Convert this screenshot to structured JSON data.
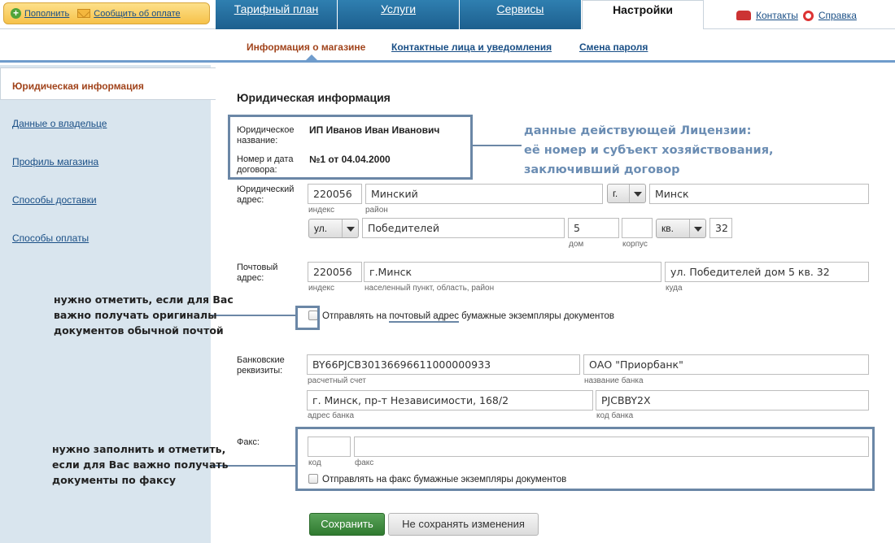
{
  "top_bar": {
    "topup_label": "Пополнить",
    "report_payment_label": "Сообщить об оплате",
    "tabs": [
      {
        "label": "Тарифный план"
      },
      {
        "label": "Услуги"
      },
      {
        "label": "Сервисы"
      },
      {
        "label": "Настройки"
      }
    ],
    "contacts_label": "Контакты",
    "help_label": "Справка"
  },
  "subnav": {
    "items": [
      {
        "label": "Информация о магазине"
      },
      {
        "label": "Контактные лица и уведомления"
      },
      {
        "label": "Смена пароля"
      }
    ]
  },
  "sidebar": {
    "items": [
      {
        "label": "Юридическая информация"
      },
      {
        "label": "Данные о владельце"
      },
      {
        "label": "Профиль магазина"
      },
      {
        "label": "Способы доставки"
      },
      {
        "label": "Способы оплаты"
      }
    ]
  },
  "form": {
    "title": "Юридическая информация",
    "legal_name_label": "Юридическое название:",
    "legal_name_value": "ИП Иванов Иван Иванович",
    "contract_label": "Номер и дата договора:",
    "contract_value": "№1 от 04.04.2000",
    "legal_address": {
      "label": "Юридический адрес:",
      "index": "220056",
      "district": "Минский",
      "locality_type": "г.",
      "locality": "Минск",
      "street_type": "ул.",
      "street": "Победителей",
      "house": "5",
      "building": "",
      "apt_type": "кв.",
      "apt": "32",
      "hint_index": "индекс",
      "hint_district": "район",
      "hint_house": "дом",
      "hint_building": "корпус"
    },
    "postal_address": {
      "label": "Почтовый адрес:",
      "index": "220056",
      "locality": "г.Минск",
      "where": "ул. Победителей  дом 5 кв. 32",
      "hint_index": "индекс",
      "hint_locality": "населенный пункт, область, район",
      "hint_where": "куда",
      "send_prefix": "Отправлять на ",
      "send_link": "почтовый адрес",
      "send_suffix": " бумажные экземпляры документов"
    },
    "bank": {
      "label": "Банковские реквизиты:",
      "account": "BY66PJCB30136696611000000933",
      "bank_name": "ОАО \"Приорбанк\"",
      "bank_address": "г. Минск, пр-т Независимости, 168/2",
      "bank_code": "PJCBBY2X",
      "hint_account": "расчетный счет",
      "hint_bank_name": "название банка",
      "hint_bank_address": "адрес банка",
      "hint_bank_code": "код банка"
    },
    "fax": {
      "label": "Факс:",
      "code": "",
      "number": "",
      "hint_code": "код",
      "hint_number": "факс",
      "send_label": "Отправлять на факс бумажные экземпляры документов"
    },
    "save_label": "Сохранить",
    "cancel_label": "Не сохранять изменения"
  },
  "annotations": {
    "license_note": [
      "данные действующей Лицензии:",
      "её номер и субъект хозяйствования,",
      "заключивший договор"
    ],
    "postal_note": [
      "нужно отметить, если для Вас",
      "важно получать оригиналы",
      "документов обычной почтой"
    ],
    "fax_note": [
      "нужно заполнить и отметить,",
      "если для Вас важно получать",
      "документы по факсу"
    ]
  },
  "colors": {
    "tab_blue": "#1d5f8e",
    "accent_orange": "#a1441c",
    "link_blue": "#1a4f86",
    "sidebar_bg": "#d9e5ee",
    "save_green": "#2f7a2f",
    "annotation": "#6b87a6"
  }
}
